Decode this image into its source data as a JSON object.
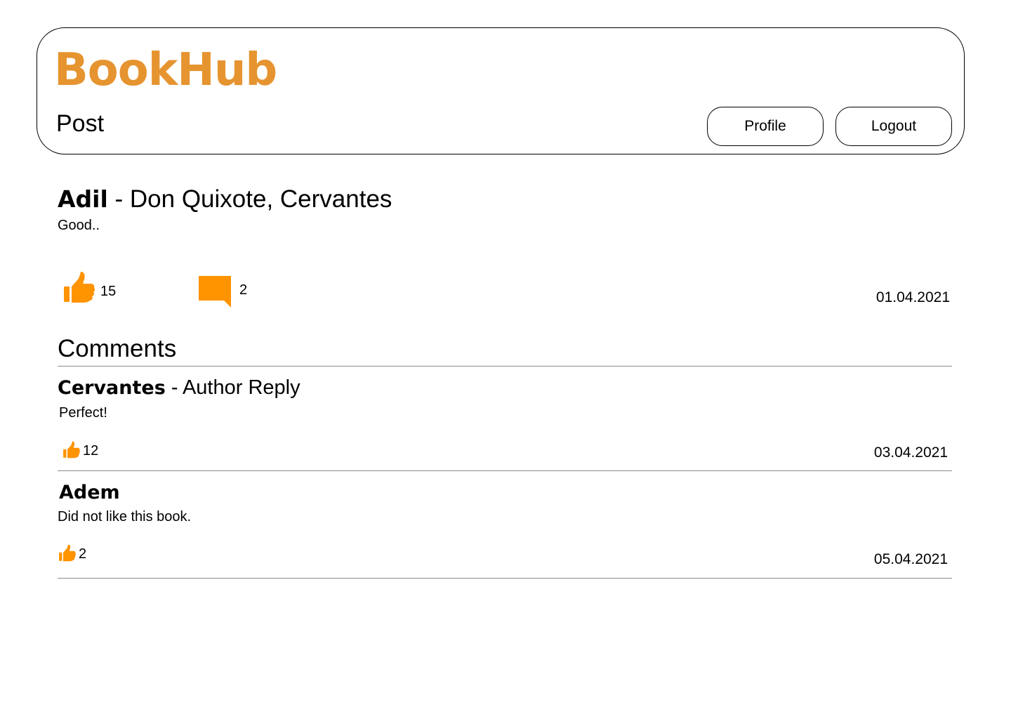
{
  "app": {
    "brand": "BookHub",
    "page_title": "Post"
  },
  "header": {
    "profile_label": "Profile",
    "logout_label": "Logout"
  },
  "post": {
    "author": "Adil",
    "separator_title": " - Don Quixote, Cervantes",
    "text": "Good..",
    "likes": "15",
    "comments": "2",
    "date": "01.04.2021"
  },
  "comments_section": {
    "title": "Comments",
    "items": [
      {
        "author": "Cervantes",
        "suffix": " - Author Reply",
        "text": "Perfect!",
        "likes": "12",
        "date": "03.04.2021"
      },
      {
        "author": "Adem",
        "suffix": "",
        "text": "Did not like this book.",
        "likes": "2",
        "date": "05.04.2021"
      }
    ]
  },
  "colors": {
    "brand": "#E69430",
    "icon": "#FF9300"
  },
  "icons": {
    "like": "thumbs-up-icon",
    "comment": "comment-bubble-icon"
  }
}
